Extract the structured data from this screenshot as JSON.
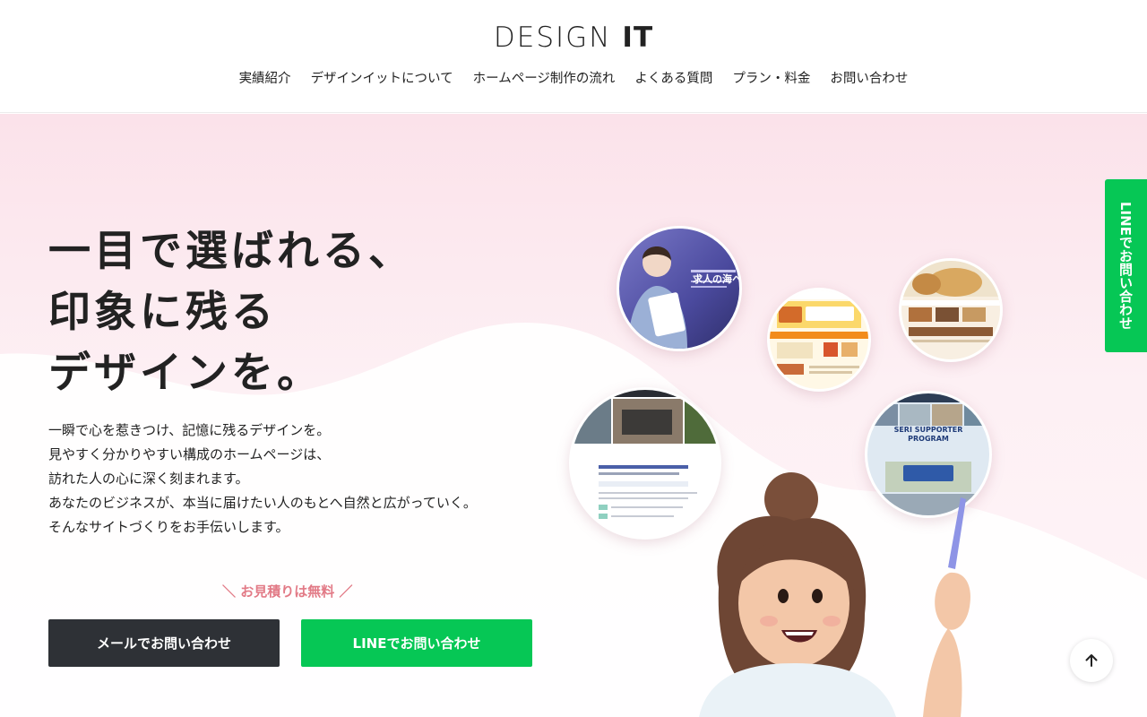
{
  "header": {
    "logo_light": "DESIGN",
    "logo_bold": "IT",
    "nav": [
      "実績紹介",
      "デザインイットについて",
      "ホームページ制作の流れ",
      "よくある質問",
      "プラン・料金",
      "お問い合わせ"
    ]
  },
  "hero": {
    "headline": [
      "一目で選ばれる、",
      "印象に残る",
      "デザインを。"
    ],
    "lead": [
      "一瞬で心を惹きつけ、記憶に残るデザインを。",
      "見やすく分かりやすい構成のホームページは、",
      "訪れた人の心に深く刻まれます。",
      "あなたのビジネスが、本当に届けたい人のもとへ自然と広がっていく。",
      "そんなサイトづくりをお手伝いします。"
    ],
    "free_note": "＼ お見積りは無料 ／",
    "mail_button": "メールでお問い合わせ",
    "line_button": "LINEでお問い合わせ",
    "works": {
      "recruit_title": "求人の海へ",
      "seri_title_1": "SERI SUPPORTER",
      "seri_title_2": "PROGRAM"
    }
  },
  "side_line_button": "LINEでお問い合わせ",
  "icons": {
    "to_top": "arrow-up-icon"
  },
  "colors": {
    "line_green": "#06c755",
    "dark_button": "#2e3136",
    "accent_pink": "#e27a86",
    "hero_pink": "#fbe2ea"
  }
}
